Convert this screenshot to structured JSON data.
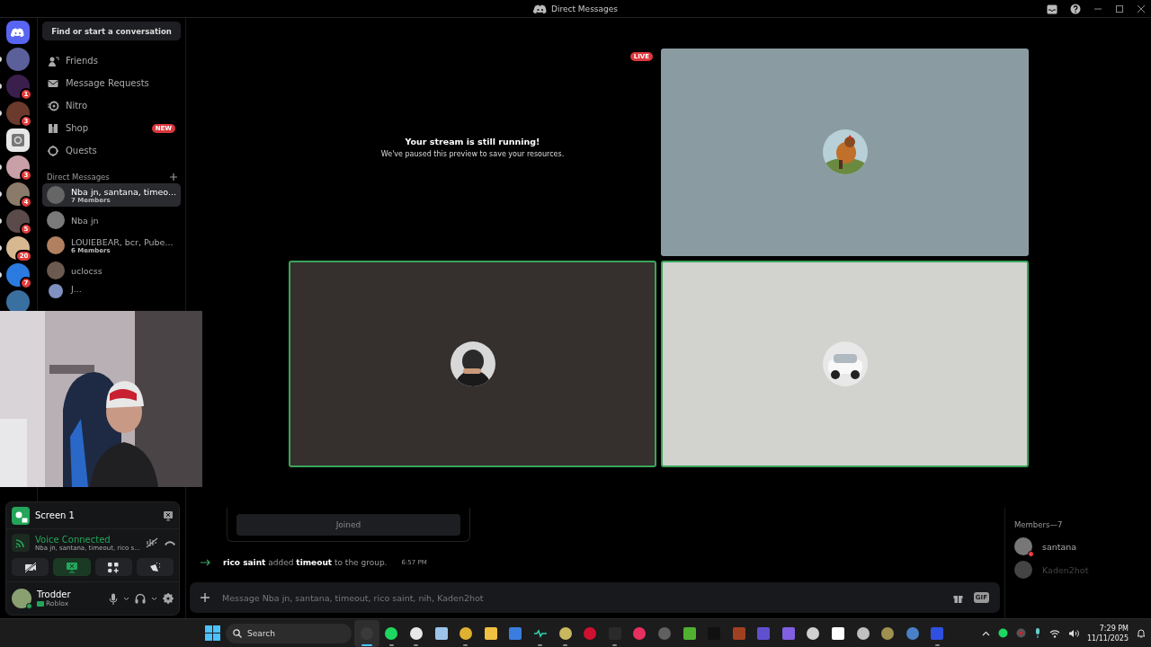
{
  "window": {
    "title": "Direct Messages"
  },
  "servers": [
    {
      "kind": "home",
      "unread": false
    },
    {
      "kind": "avatar",
      "color": "#5b5f9a",
      "unread": true
    },
    {
      "kind": "avatar",
      "color": "#3a1f4d",
      "unread": true,
      "badge": "1"
    },
    {
      "kind": "avatar",
      "color": "#6b3a2c",
      "unread": true,
      "badge": "3"
    },
    {
      "kind": "box",
      "color": "#e8e8e8",
      "unread": false
    },
    {
      "kind": "avatar",
      "color": "#c9a0a8",
      "unread": true,
      "badge": "3"
    },
    {
      "kind": "avatar",
      "color": "#8a7a6a",
      "unread": true,
      "badge": "4"
    },
    {
      "kind": "avatar",
      "color": "#5a4a4a",
      "unread": true,
      "badge": "5"
    },
    {
      "kind": "avatar",
      "color": "#d8b890",
      "unread": true,
      "badge": "20"
    },
    {
      "kind": "avatar",
      "color": "#2b7ae0",
      "unread": true,
      "badge": "7"
    },
    {
      "kind": "avatar",
      "color": "#3a70a0",
      "unread": false
    }
  ],
  "sidebar": {
    "search": "Find or start a conversation",
    "nav": [
      {
        "label": "Friends"
      },
      {
        "label": "Message Requests"
      },
      {
        "label": "Nitro"
      },
      {
        "label": "Shop",
        "badge": "NEW"
      },
      {
        "label": "Quests"
      }
    ],
    "dm_header": "Direct Messages",
    "dms": [
      {
        "name": "Nba jn, santana, timeo...",
        "subtitle": "7 Members",
        "selected": true,
        "color": "#666666"
      },
      {
        "name": "Nba jn",
        "selected": false,
        "color": "#7a7a7a"
      },
      {
        "name": "LOUIEBEAR, bcr, Pube...",
        "subtitle": "6 Members",
        "selected": false,
        "color": "#b08060"
      },
      {
        "name": "uclocss",
        "selected": false,
        "color": "#6a5a50"
      },
      {
        "name": "J...",
        "selected": false,
        "color": "#8090c0"
      }
    ]
  },
  "voice_panel": {
    "stream_label": "Screen 1",
    "status": "Voice Connected",
    "channel": "Nba jn, santana, timeout, rico s...",
    "buttons": [
      {
        "kind": "camera",
        "active": false
      },
      {
        "kind": "screen",
        "active": true
      },
      {
        "kind": "activities",
        "active": false
      },
      {
        "kind": "soundboard",
        "active": false
      }
    ]
  },
  "user": {
    "name": "Trodder",
    "activity": "Roblox"
  },
  "stage": {
    "live": "LIVE",
    "paused_title": "Your stream is still running!",
    "paused_text": "We've paused this preview to save your resources.",
    "tiles": [
      {
        "color": "#8b9ba2",
        "speaking": false
      },
      {
        "color": "#352f2e",
        "speaking": true
      },
      {
        "color": "#d2d3cf",
        "speaking": true
      }
    ]
  },
  "chat": {
    "joined_button": "Joined",
    "system_message": "**rico saint** added **timeout** to the group.",
    "system_time": "6:57 PM",
    "input": {
      "placeholder": "Message Nba jn, santana, timeout, rico saint, nih, Kaden2hot"
    },
    "gif": "GIF"
  },
  "members": {
    "header": "Members—7",
    "items": [
      {
        "name": "santana",
        "do_not_disturb": true,
        "offline": false
      },
      {
        "name": "Kaden2hot",
        "do_not_disturb": false,
        "offline": true
      }
    ]
  },
  "taskbar": {
    "search": "Search",
    "time": "7:29 PM",
    "date": "11/11/2025",
    "apps": [
      {
        "kind": "circle",
        "color": "#3a3a3a",
        "running": true,
        "active": true
      },
      {
        "kind": "circle",
        "color": "#1ed760",
        "running": true,
        "active": false
      },
      {
        "kind": "circle",
        "color": "#e8e8e8",
        "running": true,
        "active": false
      },
      {
        "kind": "square",
        "color": "#9cc4e8",
        "running": false,
        "active": false
      },
      {
        "kind": "circle",
        "color": "#e0b030",
        "running": true,
        "active": false
      },
      {
        "kind": "square",
        "color": "#f0c040",
        "running": false,
        "active": false
      },
      {
        "kind": "square",
        "color": "#3a7de0",
        "running": false,
        "active": false
      },
      {
        "kind": "line",
        "color": "#30d0b0",
        "running": true,
        "active": false
      },
      {
        "kind": "circle",
        "color": "#c8b860",
        "running": true,
        "active": false
      },
      {
        "kind": "circle",
        "color": "#d01030",
        "running": false,
        "active": false
      },
      {
        "kind": "square",
        "color": "#2a2a2a",
        "running": true,
        "active": false
      },
      {
        "kind": "circle",
        "color": "#e83060",
        "running": false,
        "active": false
      },
      {
        "kind": "circle",
        "color": "#606060",
        "running": false,
        "active": false
      },
      {
        "kind": "square",
        "color": "#50b030",
        "running": false,
        "active": false
      },
      {
        "kind": "square",
        "color": "#111111",
        "running": false,
        "active": false
      },
      {
        "kind": "square",
        "color": "#a04020",
        "running": false,
        "active": false
      },
      {
        "kind": "square",
        "color": "#6050d0",
        "running": false,
        "active": false
      },
      {
        "kind": "square",
        "color": "#8060e0",
        "running": false,
        "active": false
      },
      {
        "kind": "circle",
        "color": "#d0d0d0",
        "running": false,
        "active": false
      },
      {
        "kind": "square",
        "color": "#ffffff",
        "running": false,
        "active": false
      },
      {
        "kind": "circle",
        "color": "#c0c0c0",
        "running": false,
        "active": false
      },
      {
        "kind": "circle",
        "color": "#a09050",
        "running": false,
        "active": false
      },
      {
        "kind": "circle",
        "color": "#4a80c8",
        "running": false,
        "active": false
      },
      {
        "kind": "square",
        "color": "#3050e0",
        "running": true,
        "active": false
      }
    ]
  }
}
